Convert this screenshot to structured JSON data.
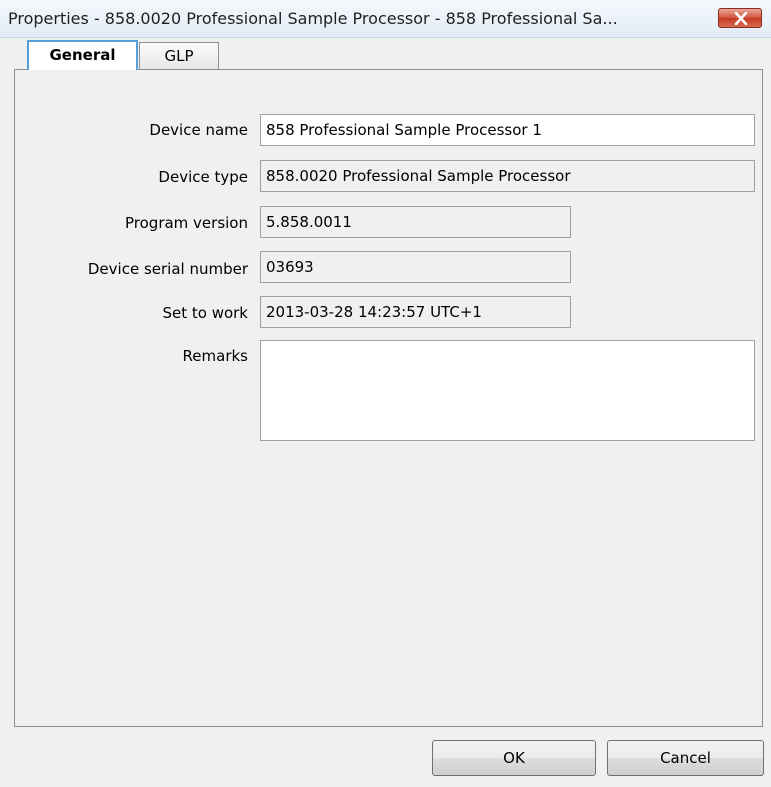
{
  "window": {
    "title": "Properties - 858.0020 Professional Sample Processor - 858 Professional Sa...",
    "close_icon": "close-icon"
  },
  "tabs": [
    {
      "label": "General",
      "active": true
    },
    {
      "label": "GLP",
      "active": false
    }
  ],
  "form": {
    "device_name": {
      "label": "Device name",
      "value": "858 Professional Sample Processor 1"
    },
    "device_type": {
      "label": "Device type",
      "value": "858.0020 Professional Sample Processor"
    },
    "program_version": {
      "label": "Program version",
      "value": "5.858.0011"
    },
    "serial_number": {
      "label": "Device serial number",
      "value": "03693"
    },
    "set_to_work": {
      "label": "Set to work",
      "value": "2013-03-28 14:23:57 UTC+1"
    },
    "remarks": {
      "label": "Remarks",
      "value": ""
    }
  },
  "buttons": {
    "ok": "OK",
    "cancel": "Cancel"
  },
  "colors": {
    "close_button": "#c94a33",
    "active_tab_border": "#5a9ed6"
  }
}
